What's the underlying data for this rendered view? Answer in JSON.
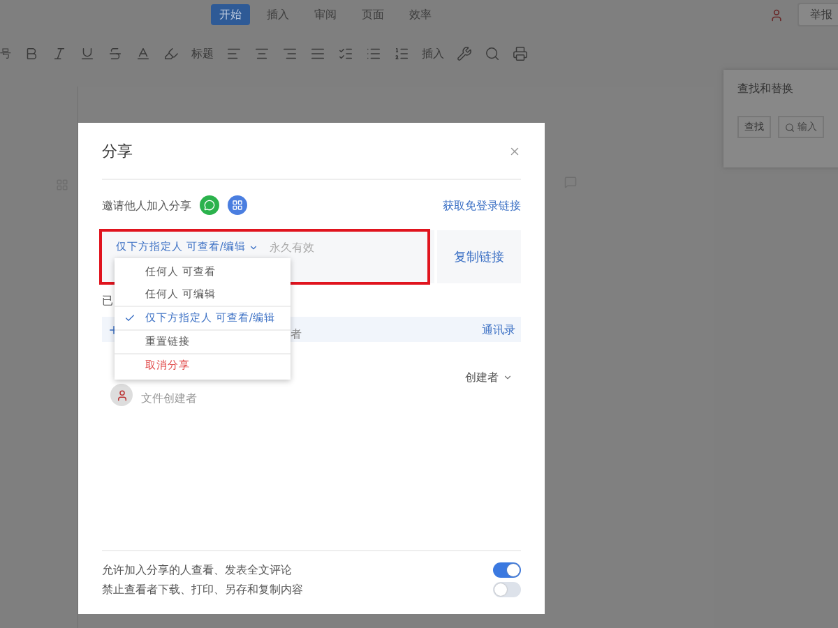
{
  "tabs": [
    {
      "label": "开始",
      "selected": true
    },
    {
      "label": "插入",
      "selected": false
    },
    {
      "label": "审阅",
      "selected": false
    },
    {
      "label": "页面",
      "selected": false
    },
    {
      "label": "效率",
      "selected": false
    }
  ],
  "report_button": "举报",
  "toolbar": {
    "font_size": "号",
    "heading": "标题",
    "insert": "插入"
  },
  "find_panel": {
    "title": "查找和替换",
    "mode": "查找",
    "placeholder": "输入"
  },
  "dialog": {
    "title": "分享",
    "invite_label": "邀请他人加入分享",
    "login_free_link": "获取免登录链接",
    "permission": "仅下方指定人 可查看/编辑",
    "validity": "永久有效",
    "copy_link": "复制链接",
    "highlighted": true,
    "menu": [
      {
        "label": "任何人 可查看",
        "kind": "option",
        "selected": false
      },
      {
        "label": "任何人 可编辑",
        "kind": "option",
        "selected": false
      },
      {
        "label": "仅下方指定人 可查看/编辑",
        "kind": "option",
        "selected": true
      },
      {
        "label": "重置链接",
        "kind": "action",
        "selected": false
      },
      {
        "label": "取消分享",
        "kind": "danger",
        "selected": false
      }
    ],
    "members_heading": "已",
    "member_search_tail": "者",
    "contacts": "通讯录",
    "member": {
      "caption": "文件创建者",
      "role": "创建者"
    },
    "settings": [
      {
        "label": "允许加入分享的人查看、发表全文评论",
        "on": true
      },
      {
        "label": "禁止查看者下载、打印、另存和复制内容",
        "on": false
      }
    ]
  }
}
